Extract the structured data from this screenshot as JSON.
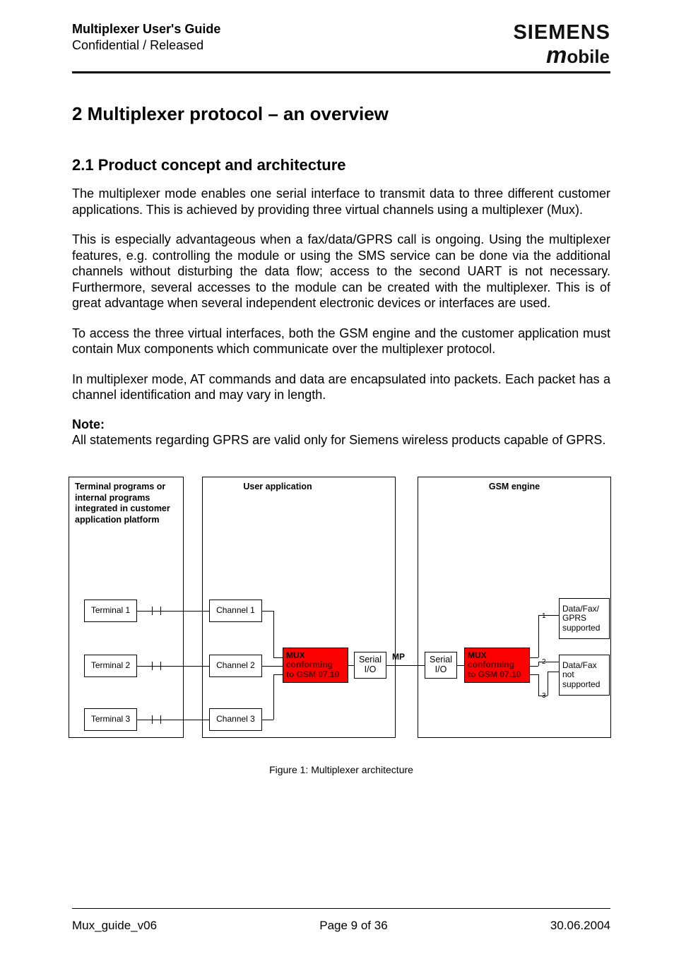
{
  "header": {
    "title": "Multiplexer User's Guide",
    "subtitle": "Confidential / Released",
    "logo_top": "SIEMENS",
    "logo_bottom_m": "m",
    "logo_bottom_rest": "obile"
  },
  "headings": {
    "h2": "2   Multiplexer protocol – an overview",
    "h3": "2.1  Product concept and architecture"
  },
  "paragraphs": {
    "p1": "The multiplexer mode enables one serial interface to transmit data to three different customer applications. This is achieved by providing three virtual channels using a multiplexer (Mux).",
    "p2": "This is especially advantageous when a fax/data/GPRS call is ongoing. Using the multiplexer features, e.g. controlling the module or using the SMS service can be done via the additional channels without disturbing the data flow; access to the second UART is not necessary. Furthermore, several accesses to the module can be created with the multiplexer. This is of great advantage when several independent electronic devices or interfaces are used.",
    "p3": "To access the three virtual interfaces, both the GSM engine and the customer application must contain Mux components which communicate over the multiplexer protocol.",
    "p4": "In multiplexer mode, AT commands and data are encapsulated into packets. Each packet has a channel identification and may vary in length.",
    "note_label": "Note:",
    "note": "All statements regarding GPRS are valid only for Siemens wireless products capable of GPRS."
  },
  "diagram": {
    "col1_label": "Terminal programs or internal programs integrated in customer application platform",
    "col2_label": "User application",
    "col3_label": "GSM engine",
    "terminals": [
      "Terminal 1",
      "Terminal 2",
      "Terminal 3"
    ],
    "channels": [
      "Channel 1",
      "Channel 2",
      "Channel 3"
    ],
    "mux_l1": "MUX",
    "mux_l2": "conforming",
    "mux_l3": "to GSM 07.10",
    "serial": "Serial I/O",
    "mp": "MP",
    "data1": "Data/Fax/ GPRS supported",
    "data2": "Data/Fax not supported",
    "n1": "1",
    "n2": "2",
    "n3": "3",
    "caption": "Figure 1: Multiplexer architecture"
  },
  "footer": {
    "left": "Mux_guide_v06",
    "center": "Page 9 of 36",
    "right": "30.06.2004"
  }
}
